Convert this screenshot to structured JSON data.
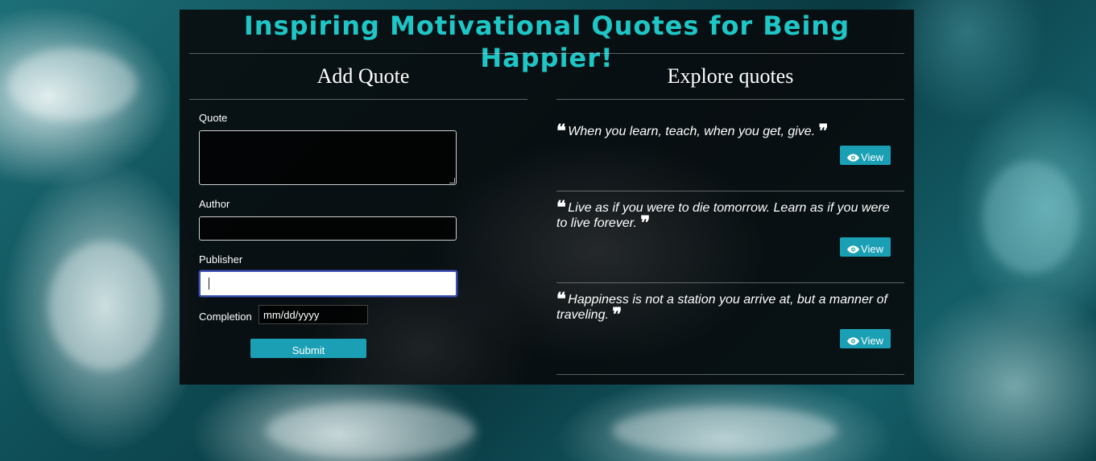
{
  "page": {
    "title": "Inspiring Motivational Quotes for Being Happier!"
  },
  "add_quote": {
    "heading": "Add Quote",
    "quote_label": "Quote",
    "quote_value": "",
    "author_label": "Author",
    "author_value": "",
    "publisher_label": "Publisher",
    "publisher_value": "",
    "completion_label": "Completion",
    "completion_placeholder": "mm/dd/yyyy",
    "submit_label": "Submit"
  },
  "explore": {
    "heading": "Explore quotes",
    "quotes": [
      {
        "text": "When you learn, teach, when you get, give.",
        "view_label": "View"
      },
      {
        "text": "Live as if you were to die tomorrow. Learn as if you were to live forever.",
        "view_label": "View"
      },
      {
        "text": "Happiness is not a station you arrive at, but a manner of traveling.",
        "view_label": "View"
      }
    ],
    "open_quote_glyph": "❝",
    "close_quote_glyph": "❞"
  },
  "colors": {
    "title": "#1ec6c6",
    "button": "#1a9fb4",
    "focus_border": "#3b4fb8"
  },
  "icons": {
    "view": "eye-icon",
    "open_quote": "quote-left-icon",
    "close_quote": "quote-right-icon"
  }
}
